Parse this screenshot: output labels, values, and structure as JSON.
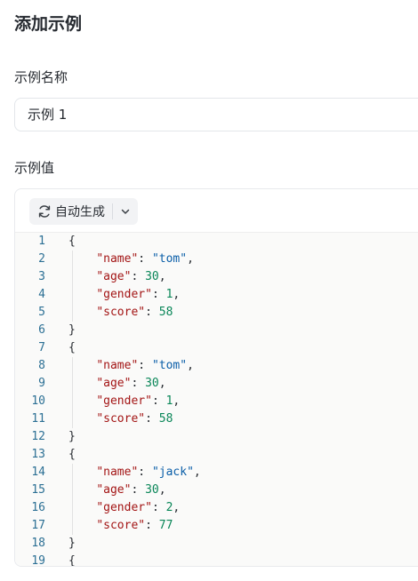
{
  "page": {
    "title": "添加示例"
  },
  "example_name": {
    "label": "示例名称",
    "value": "示例 1"
  },
  "example_value": {
    "label": "示例值",
    "auto_generate_label": "自动生成",
    "icons": {
      "generate": "refresh-icon",
      "dropdown": "chevron-down-icon"
    }
  },
  "code": {
    "line_numbers": [
      "1",
      "2",
      "3",
      "4",
      "5",
      "6",
      "7",
      "8",
      "9",
      "10",
      "11",
      "12",
      "13",
      "14",
      "15",
      "16",
      "17",
      "18",
      "19"
    ],
    "lines": [
      "{",
      "    \"name\": \"tom\",",
      "    \"age\": 30,",
      "    \"gender\": 1,",
      "    \"score\": 58",
      "}",
      "{",
      "    \"name\": \"tom\",",
      "    \"age\": 30,",
      "    \"gender\": 1,",
      "    \"score\": 58",
      "}",
      "{",
      "    \"name\": \"jack\",",
      "    \"age\": 30,",
      "    \"gender\": 2,",
      "    \"score\": 77",
      "}",
      "{"
    ]
  }
}
